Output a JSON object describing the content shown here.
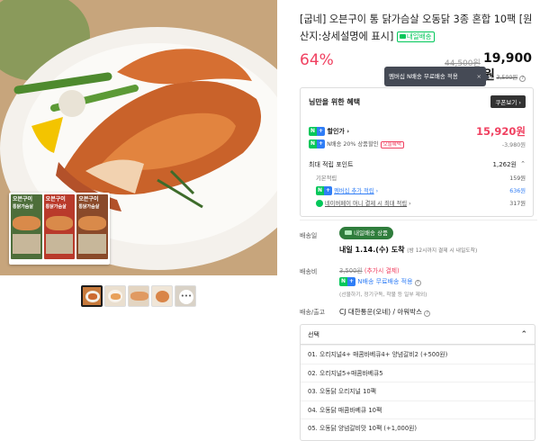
{
  "product": {
    "title": "[굽네] 오븐구이 통 닭가슴살 오동닭 3종 혼합 10팩 [원산지:상세설명에 표시]",
    "delivery_badge": "내일배송",
    "discount_rate": "64%",
    "original_price": "44,500원",
    "price": "19,900원"
  },
  "tooltip": {
    "text": "멤버십 N배송 무료배송 적용",
    "close": "×"
  },
  "shipping_strike": {
    "prefix": "ⓒ",
    "value": "3,500원"
  },
  "benefit": {
    "title": "님만을 위한 혜택",
    "coupon_button": "쿠폰보기",
    "discount_label": "할인가",
    "discount_price": "15,920원",
    "ndelivery_label": "N배송 20% 상품할인",
    "today_badge": "오늘혜택",
    "ndelivery_amount": "-3,980원",
    "points_title": "최대 적립 포인트",
    "points_total": "1,262원",
    "basic_label": "기본적립",
    "basic_value": "159원",
    "membership_label": "멤버십 추가 적립",
    "membership_value": "636원",
    "naver_label": "네이버페이 머니 결제 시 최대 적립",
    "naver_value": "317원"
  },
  "delivery": {
    "label": "배송일",
    "badge": "내일배송 상품",
    "date": "내일 1.14.(수) 도착",
    "note": "(밤 12시까지 결제 시 내일도착)"
  },
  "fee": {
    "label": "배송비",
    "strike": "3,500원",
    "note": "(추가시 결제)",
    "free": "N배송 무료배송 적용",
    "sub": "(선물하기, 정기구독, 착불 등 일부 제외)"
  },
  "courier": {
    "label": "배송/출고",
    "value": "CJ 대한통운(오네) / 아워박스"
  },
  "options": {
    "header": "선택",
    "items": [
      "01. 오리지널4+ 매콤바베큐4+ 양념갈비2 (+500원)",
      "02. 오리지널5+매콤바베큐5",
      "03. 오동닭 오리지널 10팩",
      "04. 오동닭 매콤바베큐 10팩",
      "05. 오동닭 양념갈비맛 10팩 (+1,000원)"
    ]
  },
  "packs": [
    {
      "name": "오븐구이",
      "sub": "통닭가슴살",
      "color": "#4d6e3a"
    },
    {
      "name": "오븐구이",
      "sub": "통닭가슴살",
      "color": "#b93a2b"
    },
    {
      "name": "오븐구이",
      "sub": "통닭가슴살",
      "color": "#8a4a2a"
    }
  ],
  "colors": {
    "accent": "#f04060",
    "green": "#03c75a",
    "blue": "#2f7df6"
  }
}
